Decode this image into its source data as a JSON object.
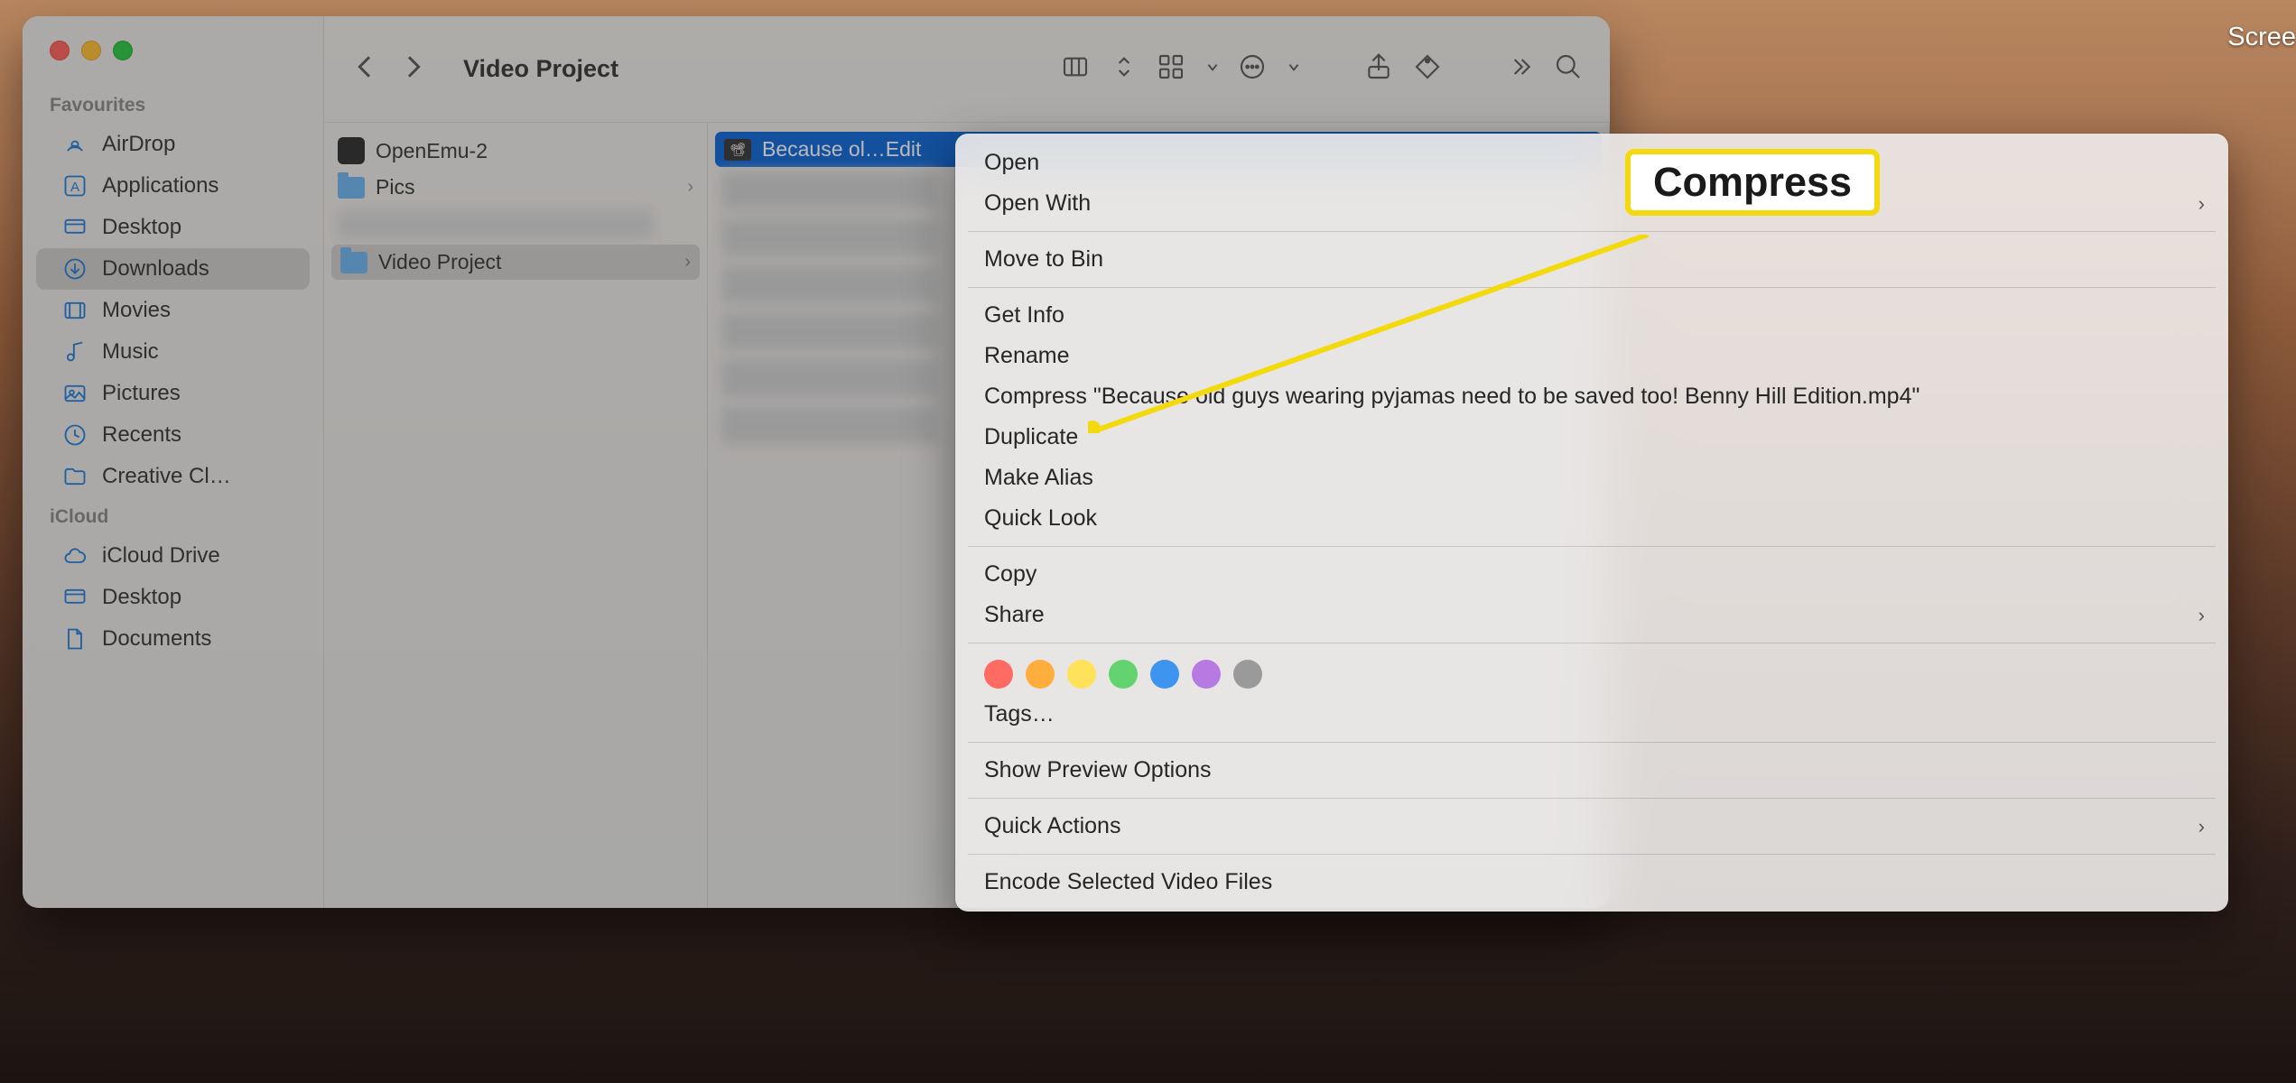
{
  "desktop": {
    "partial_icon_label": "Scree"
  },
  "window": {
    "title": "Video Project",
    "traffic": [
      "close",
      "minimize",
      "zoom"
    ]
  },
  "sidebar": {
    "sections": [
      {
        "header": "Favourites",
        "items": [
          {
            "icon": "airdrop",
            "label": "AirDrop"
          },
          {
            "icon": "apps",
            "label": "Applications"
          },
          {
            "icon": "desktop",
            "label": "Desktop"
          },
          {
            "icon": "downloads",
            "label": "Downloads",
            "selected": true
          },
          {
            "icon": "movies",
            "label": "Movies"
          },
          {
            "icon": "music",
            "label": "Music"
          },
          {
            "icon": "pictures",
            "label": "Pictures"
          },
          {
            "icon": "recents",
            "label": "Recents"
          },
          {
            "icon": "folder",
            "label": "Creative Cl…"
          }
        ]
      },
      {
        "header": "iCloud",
        "items": [
          {
            "icon": "cloud",
            "label": "iCloud Drive"
          },
          {
            "icon": "desktop",
            "label": "Desktop"
          },
          {
            "icon": "document",
            "label": "Documents"
          }
        ]
      }
    ]
  },
  "column1": {
    "items": [
      {
        "type": "app",
        "label": "OpenEmu-2"
      },
      {
        "type": "folder",
        "label": "Pics",
        "caret": true
      },
      {
        "type": "blur"
      },
      {
        "type": "folder",
        "label": "Video Project",
        "caret": true,
        "selected": true
      }
    ]
  },
  "column2": {
    "selected_label": "Because ol…Edit",
    "blur_rows": 6
  },
  "context_menu": {
    "groups": [
      [
        {
          "label": "Open"
        },
        {
          "label": "Open With",
          "submenu": true
        }
      ],
      [
        {
          "label": "Move to Bin"
        }
      ],
      [
        {
          "label": "Get Info"
        },
        {
          "label": "Rename"
        },
        {
          "label": "Compress \"Because old guys wearing pyjamas need to be saved too! Benny Hill Edition.mp4\""
        },
        {
          "label": "Duplicate"
        },
        {
          "label": "Make Alias"
        },
        {
          "label": "Quick Look"
        }
      ],
      [
        {
          "label": "Copy"
        },
        {
          "label": "Share",
          "submenu": true
        }
      ],
      [
        {
          "type": "tags",
          "colors": [
            "#ff6a62",
            "#ffae3d",
            "#ffe259",
            "#62d36f",
            "#3e95ef",
            "#b77ae3",
            "#9a9a9a"
          ]
        },
        {
          "label": "Tags…"
        }
      ],
      [
        {
          "label": "Show Preview Options"
        }
      ],
      [
        {
          "label": "Quick Actions",
          "submenu": true
        }
      ],
      [
        {
          "label": "Encode Selected Video Files"
        }
      ]
    ]
  },
  "callout": {
    "text": "Compress"
  }
}
